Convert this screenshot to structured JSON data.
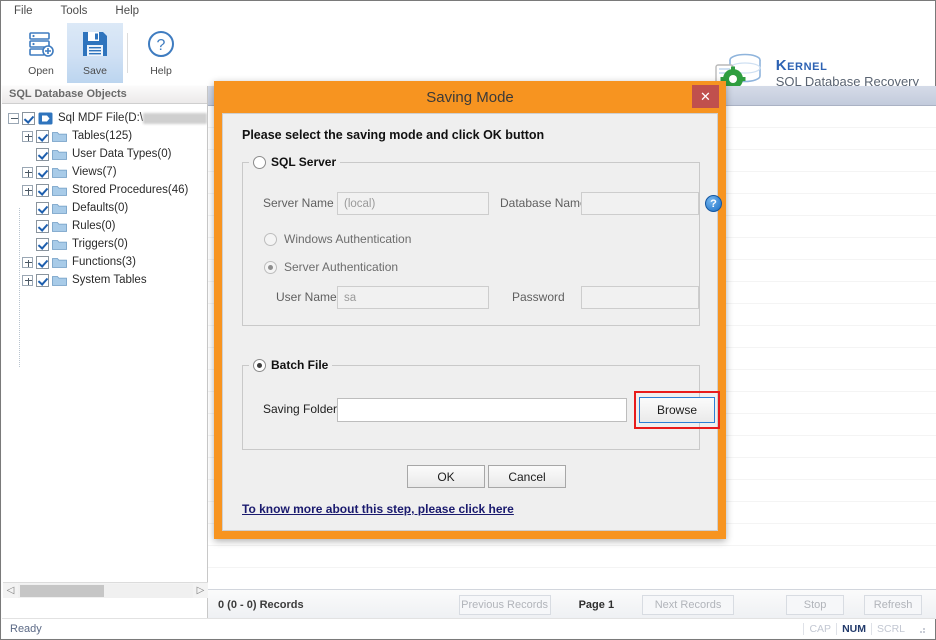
{
  "menu": {
    "items": [
      {
        "label": "File",
        "name": "menu-file"
      },
      {
        "label": "Tools",
        "name": "menu-tools"
      },
      {
        "label": "Help",
        "name": "menu-help"
      }
    ]
  },
  "toolbar": {
    "open": {
      "label": "Open",
      "icon": "open-database-icon"
    },
    "save": {
      "label": "Save",
      "icon": "save-floppy-icon"
    },
    "help": {
      "label": "Help",
      "icon": "help-question-icon"
    }
  },
  "brand": {
    "line1": "Kernel",
    "line2": "SQL Database Recovery",
    "icon": "database-gear-logo",
    "color1": "#2d62b3",
    "color2": "#5a6472"
  },
  "left_panel": {
    "header": "SQL Database Objects",
    "tree": [
      {
        "label": "Sql MDF File(D:\\",
        "redacted": true,
        "expander": "minus",
        "indent": 0,
        "icon": "mdf-file-icon"
      },
      {
        "label": "Tables(125)",
        "expander": "plus",
        "indent": 1,
        "icon": "folder-icon"
      },
      {
        "label": "User Data Types(0)",
        "expander": "none",
        "indent": 1,
        "icon": "folder-icon"
      },
      {
        "label": "Views(7)",
        "expander": "plus",
        "indent": 1,
        "icon": "folder-icon"
      },
      {
        "label": "Stored Procedures(46)",
        "expander": "plus",
        "indent": 1,
        "icon": "folder-icon"
      },
      {
        "label": "Defaults(0)",
        "expander": "none",
        "indent": 1,
        "icon": "folder-icon"
      },
      {
        "label": "Rules(0)",
        "expander": "none",
        "indent": 1,
        "icon": "folder-icon"
      },
      {
        "label": "Triggers(0)",
        "expander": "none",
        "indent": 1,
        "icon": "folder-icon"
      },
      {
        "label": "Functions(3)",
        "expander": "plus",
        "indent": 1,
        "icon": "folder-icon"
      },
      {
        "label": "System Tables",
        "expander": "plus",
        "indent": 1,
        "icon": "folder-icon"
      }
    ]
  },
  "records_bar": {
    "count": "0 (0 - 0) Records",
    "previous": "Previous Records",
    "page": "Page 1",
    "next": "Next Records",
    "stop": "Stop",
    "refresh": "Refresh"
  },
  "status_bar": {
    "ready": "Ready",
    "indicators": [
      {
        "label": "CAP",
        "active": false
      },
      {
        "label": "NUM",
        "active": true
      },
      {
        "label": "SCRL",
        "active": false
      }
    ]
  },
  "dialog": {
    "title": "Saving Mode",
    "close_icon": "close-x-icon",
    "title_bg": "#f79420",
    "close_bg": "#c0504d",
    "prompt": "Please select the saving mode and click OK button",
    "sql_server": {
      "legend": "SQL Server",
      "selected": false,
      "server_name_label": "Server Name",
      "server_name_value": "(local)",
      "database_name_label": "Database Name",
      "database_name_value": "",
      "help_icon": "help-info-icon",
      "windows_auth_label": "Windows Authentication",
      "windows_auth_selected": false,
      "server_auth_label": "Server Authentication",
      "server_auth_selected": true,
      "user_name_label": "User Name",
      "user_name_value": "sa",
      "password_label": "Password",
      "password_value": ""
    },
    "batch_file": {
      "legend": "Batch File",
      "selected": true,
      "saving_folder_label": "Saving Folder",
      "saving_folder_value": "",
      "browse_label": "Browse",
      "highlight_color": "#e81b1b"
    },
    "ok_label": "OK",
    "cancel_label": "Cancel",
    "link": "To know more about this step, please click here"
  }
}
